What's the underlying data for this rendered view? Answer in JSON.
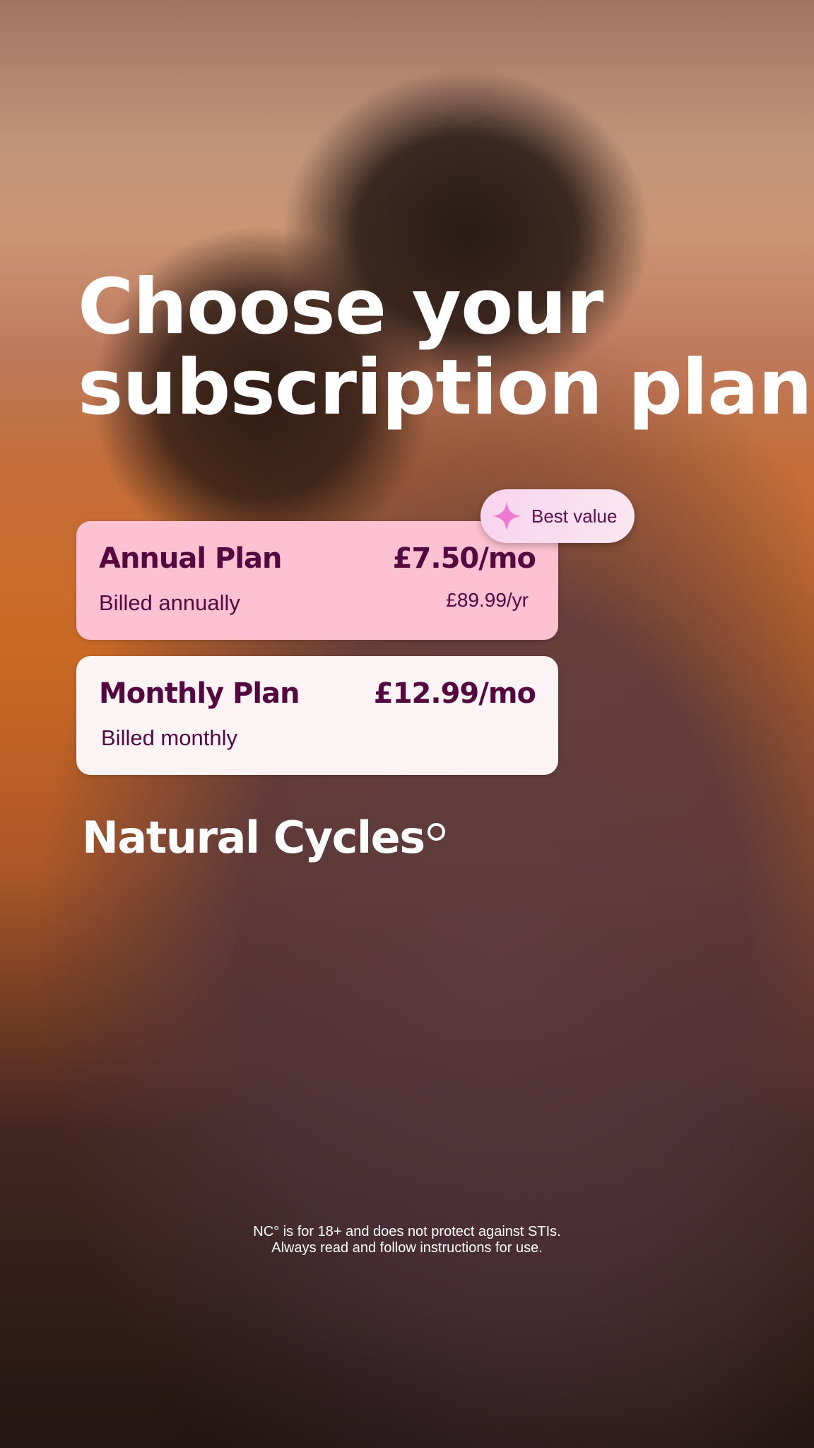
{
  "heading": {
    "line1": "Choose your",
    "line2": "subscription plan"
  },
  "badge": {
    "icon": "sparkle-icon",
    "label": "Best value",
    "icon_color": "#f07ad0"
  },
  "plans": [
    {
      "name": "Annual Plan",
      "price": "£7.50/mo",
      "billing": "Billed annually",
      "subprice": "£89.99/yr",
      "background": "#fdc1d2",
      "selected": true
    },
    {
      "name": "Monthly Plan",
      "price": "£12.99/mo",
      "billing": "Billed monthly",
      "background": "#fcf4f4",
      "selected": false
    }
  ],
  "brand": {
    "name": "Natural Cycles"
  },
  "disclaimer": {
    "line1": "NC° is for 18+ and does not protect against STIs.",
    "line2": "Always read and follow instructions for use."
  },
  "colors": {
    "text_dark": "#55083f",
    "text_light": "#ffffff"
  }
}
